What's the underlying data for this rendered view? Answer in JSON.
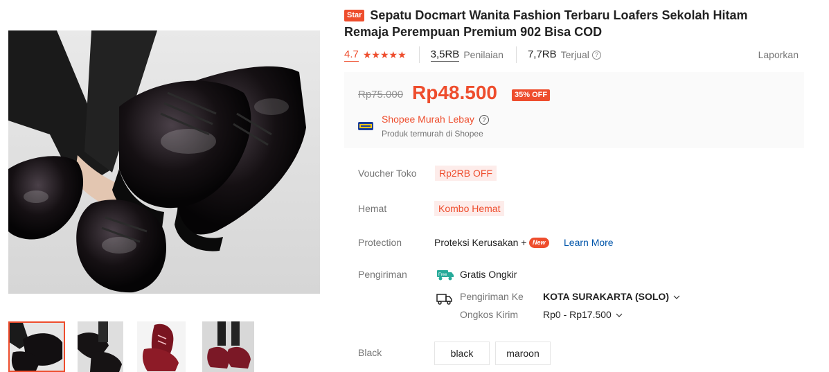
{
  "product": {
    "badge": "Star",
    "title": "Sepatu Docmart Wanita Fashion Terbaru Loafers Sekolah Hitam Remaja Perempuan Premium 902 Bisa COD"
  },
  "rating": {
    "score": "4.7",
    "stars": "★★★★★",
    "reviews_count": "3,5RB",
    "reviews_label": "Penilaian",
    "sold_count": "7,7RB",
    "sold_label": "Terjual",
    "report": "Laporkan"
  },
  "price": {
    "original": "Rp75.000",
    "current": "Rp48.500",
    "discount": "35% OFF"
  },
  "promo": {
    "title": "Shopee Murah Lebay",
    "subtitle": "Produk termurah di Shopee"
  },
  "details": {
    "voucher_label": "Voucher Toko",
    "voucher_value": "Rp2RB OFF",
    "hemat_label": "Hemat",
    "hemat_value": "Kombo Hemat",
    "protection_label": "Protection",
    "protection_value": "Proteksi Kerusakan +",
    "protection_badge": "New",
    "learn_more": "Learn More",
    "shipping_label": "Pengiriman",
    "free_shipping": "Gratis Ongkir",
    "free_icon_text": "Free",
    "ship_to_label": "Pengiriman Ke",
    "ship_to_value": "KOTA SURAKARTA (SOLO)",
    "ship_cost_label": "Ongkos Kirim",
    "ship_cost_value": "Rp0 - Rp17.500"
  },
  "variants": {
    "label": "Black",
    "options": [
      "black",
      "maroon"
    ]
  },
  "colors": {
    "accent": "#ee4d2d",
    "link": "#0055aa",
    "muted": "#757575"
  }
}
